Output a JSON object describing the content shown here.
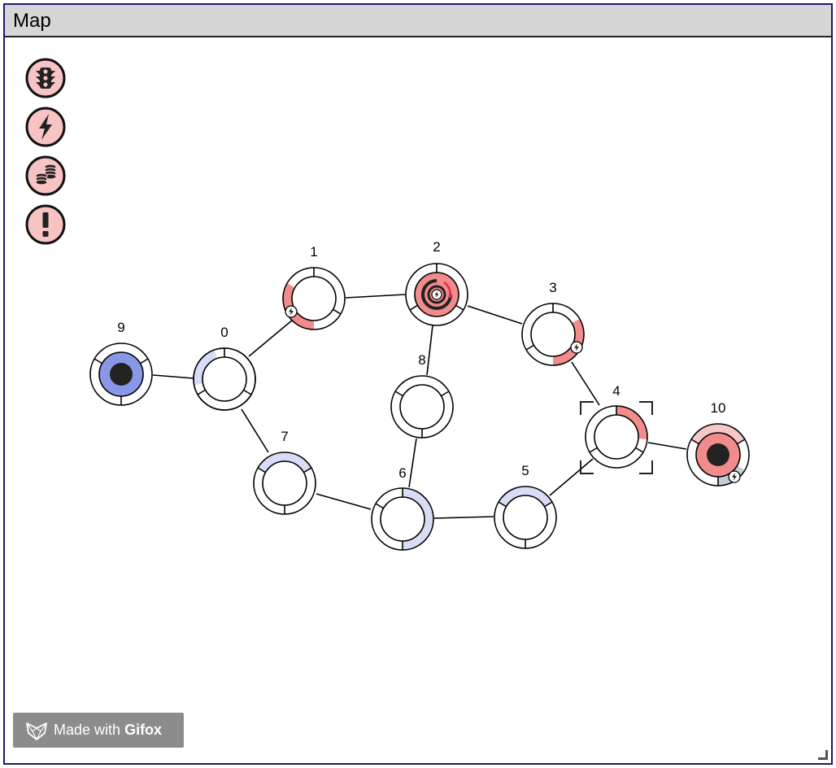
{
  "window": {
    "title": "Map"
  },
  "toolbar": [
    {
      "name": "traffic-light-icon"
    },
    {
      "name": "lightning-icon"
    },
    {
      "name": "coins-icon"
    },
    {
      "name": "exclamation-icon"
    }
  ],
  "colors": {
    "red": "#f28b8b",
    "red_light": "#f7c7c7",
    "blue": "#8a97e6",
    "blue_light": "#d9dcf7",
    "gray": "#c6ccd6",
    "button_fill": "#f8c3c3",
    "dark": "#222222"
  },
  "nodes": [
    {
      "id": "0",
      "label": "0"
    },
    {
      "id": "1",
      "label": "1"
    },
    {
      "id": "2",
      "label": "2"
    },
    {
      "id": "3",
      "label": "3"
    },
    {
      "id": "4",
      "label": "4"
    },
    {
      "id": "5",
      "label": "5"
    },
    {
      "id": "6",
      "label": "6"
    },
    {
      "id": "7",
      "label": "7"
    },
    {
      "id": "8",
      "label": "8"
    },
    {
      "id": "9",
      "label": "9"
    },
    {
      "id": "10",
      "label": "10"
    }
  ],
  "edges": [
    [
      "9",
      "0"
    ],
    [
      "0",
      "1"
    ],
    [
      "1",
      "2"
    ],
    [
      "2",
      "3"
    ],
    [
      "2",
      "8"
    ],
    [
      "3",
      "4"
    ],
    [
      "4",
      "10"
    ],
    [
      "4",
      "5"
    ],
    [
      "5",
      "6"
    ],
    [
      "6",
      "8"
    ],
    [
      "6",
      "7"
    ],
    [
      "7",
      "0"
    ]
  ],
  "selected_node": "4",
  "watermark": {
    "prefix": "Made with",
    "brand": "Gifox"
  }
}
